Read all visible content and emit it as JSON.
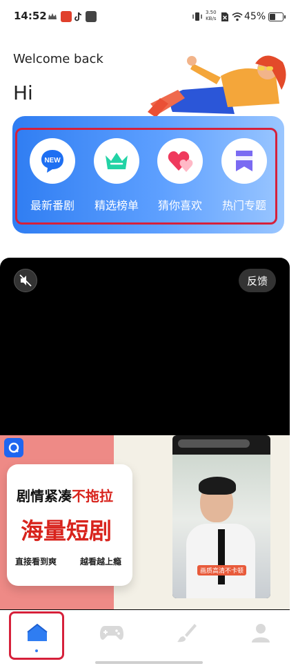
{
  "status_bar": {
    "time": "14:52",
    "net_speed_value": "3.50",
    "net_speed_unit": "KB/s",
    "battery_percent": "45%"
  },
  "header": {
    "welcome": "Welcome back",
    "greeting": "Hi"
  },
  "categories": [
    {
      "label": "最新番剧",
      "icon": "new-badge-icon",
      "badge": "NEW"
    },
    {
      "label": "精选榜单",
      "icon": "crown-icon"
    },
    {
      "label": "猜你喜欢",
      "icon": "hearts-icon"
    },
    {
      "label": "热门专题",
      "icon": "bookmark-icon"
    }
  ],
  "video": {
    "feedback_label": "反馈",
    "mute_icon": "mute-icon"
  },
  "ad": {
    "line1_black": "剧情紧凑",
    "line1_red": "不拖拉",
    "line2": "海量短剧",
    "line3_left": "直接看到爽",
    "line3_right": "越看越上瘾",
    "phone_caption": "画质高清不卡顿"
  },
  "bottom_nav": [
    {
      "name": "home",
      "icon": "home-icon",
      "active": true
    },
    {
      "name": "games",
      "icon": "gamepad-icon",
      "active": false
    },
    {
      "name": "create",
      "icon": "brush-icon",
      "active": false
    },
    {
      "name": "profile",
      "icon": "person-icon",
      "active": false
    }
  ],
  "colors": {
    "accent": "#2f7df2",
    "highlight_red": "#d6203a"
  }
}
